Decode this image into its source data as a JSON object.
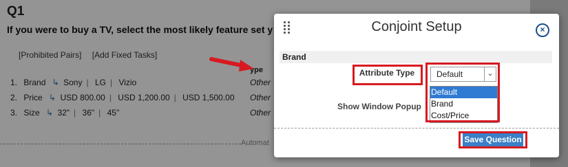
{
  "background": {
    "question_title": "Q1",
    "question_text": "If you were to buy a TV, select the most likely feature set y",
    "links": [
      "[Prohibited Pairs]",
      "[Add Fixed Tasks]"
    ],
    "type_header": "ype",
    "attributes": [
      {
        "num": "1.",
        "name": "Brand",
        "levels": [
          "Sony",
          "LG",
          "Vizio"
        ],
        "type": "Other"
      },
      {
        "num": "2.",
        "name": "Price",
        "levels": [
          "USD 800.00",
          "USD 1,200.00",
          "USD 1,500.00"
        ],
        "type": "Other"
      },
      {
        "num": "3.",
        "name": "Size",
        "levels": [
          "32\"",
          "36\"",
          "45\""
        ],
        "type": "Other"
      }
    ],
    "footer_text": "Automat"
  },
  "modal": {
    "title": "Conjoint Setup",
    "close_icon": "×",
    "section_label": "Brand",
    "attribute_type_label": "Attribute Type",
    "select_value": "Default",
    "dropdown_options": [
      "Default",
      "Brand",
      "Cost/Price"
    ],
    "selected_option": "Default",
    "show_window_popup_label": "Show Window Popup",
    "save_button_label": "Save Question"
  },
  "colors": {
    "highlight": "#d71920",
    "accent": "#3a7fc7",
    "overlay": "rgba(0,0,0,0.42)"
  }
}
